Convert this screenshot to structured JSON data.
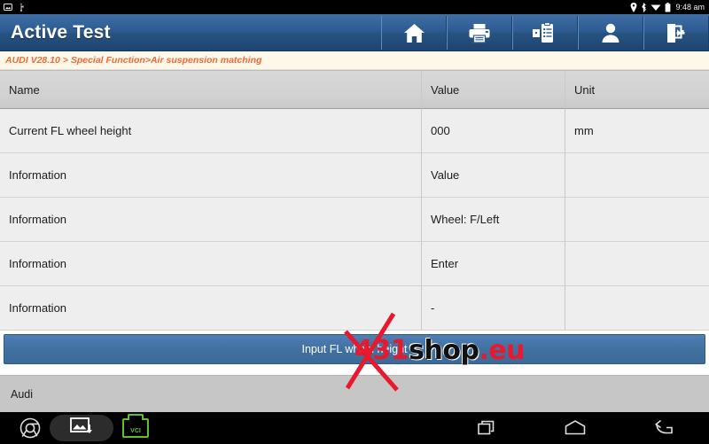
{
  "statusbar": {
    "left_icons": [
      "screenshot-icon",
      "usb-icon"
    ],
    "right_icons": [
      "location-pin-icon",
      "bluetooth-icon",
      "wifi-icon",
      "battery-icon"
    ],
    "time": "9:48 am"
  },
  "header": {
    "title": "Active Test",
    "accent_color": "#2e5c92",
    "toolbar": [
      {
        "name": "home-button",
        "icon": "home-icon"
      },
      {
        "name": "print-button",
        "icon": "printer-icon"
      },
      {
        "name": "report-button",
        "icon": "report-icon"
      },
      {
        "name": "user-button",
        "icon": "user-icon"
      },
      {
        "name": "exit-button",
        "icon": "exit-icon"
      }
    ]
  },
  "breadcrumb": {
    "text": "AUDI V28.10 > Special Function>Air suspension matching",
    "color": "#f26a34"
  },
  "table": {
    "columns": [
      "Name",
      "Value",
      "Unit"
    ],
    "rows": [
      {
        "name": "Current FL wheel height",
        "value": "000",
        "unit": "mm"
      },
      {
        "name": "Information",
        "value": "Value",
        "unit": ""
      },
      {
        "name": "Information",
        "value": "Wheel: F/Left",
        "unit": ""
      },
      {
        "name": "Information",
        "value": "Enter",
        "unit": ""
      },
      {
        "name": "Information",
        "value": "-",
        "unit": ""
      }
    ]
  },
  "action": {
    "label": "Input FL wheel height"
  },
  "bottom": {
    "vehicle": "Audi"
  },
  "watermark": {
    "part_x": "X",
    "part_431": "431",
    "part_shop": "shop",
    "part_eu": ".eu",
    "red": "#e8192c",
    "black": "#111111"
  },
  "navbar": {
    "left": [
      {
        "name": "browser-icon"
      },
      {
        "name": "screenshot-icon"
      },
      {
        "name": "vci-icon",
        "label": "VCI"
      }
    ],
    "right": [
      {
        "name": "recents-icon"
      },
      {
        "name": "home-icon"
      },
      {
        "name": "back-icon"
      }
    ]
  }
}
